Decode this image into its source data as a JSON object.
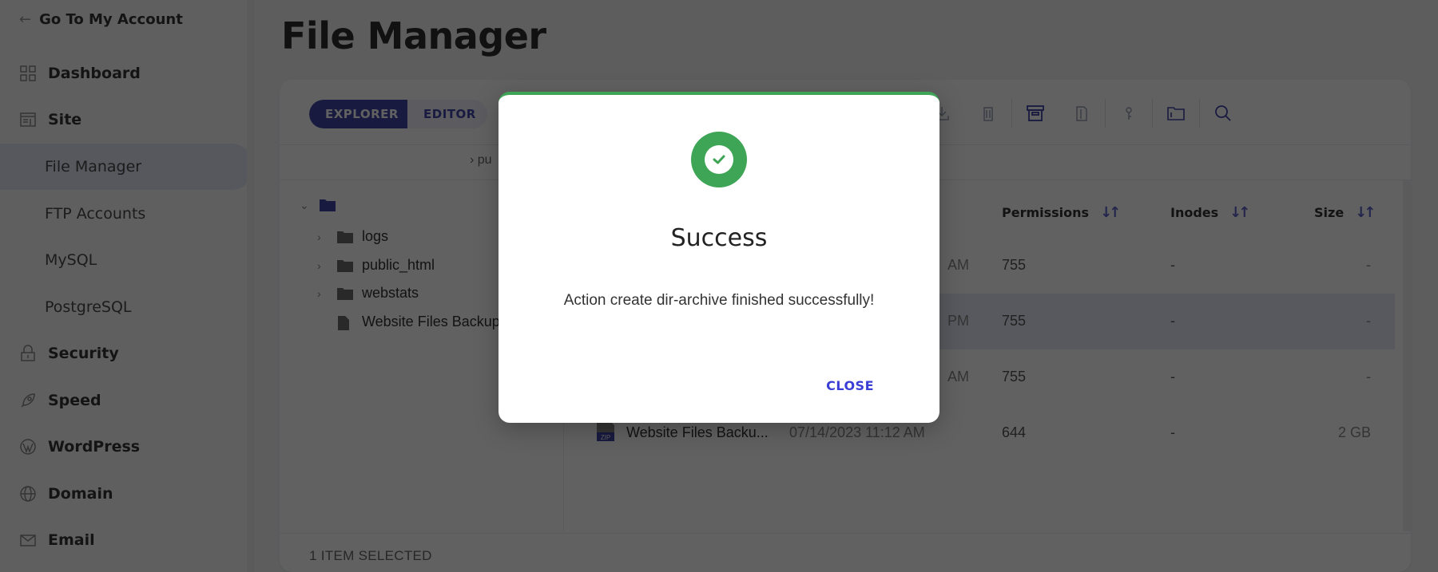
{
  "sidebar": {
    "back_label": "Go To My Account",
    "items": [
      {
        "label": "Dashboard",
        "icon": "dashboard-grid-icon"
      },
      {
        "label": "Site",
        "icon": "site-icon"
      },
      {
        "label": "File Manager",
        "sub": true,
        "active": true
      },
      {
        "label": "FTP Accounts",
        "sub": true
      },
      {
        "label": "MySQL",
        "sub": true
      },
      {
        "label": "PostgreSQL",
        "sub": true
      },
      {
        "label": "Security",
        "icon": "lock-icon"
      },
      {
        "label": "Speed",
        "icon": "rocket-icon"
      },
      {
        "label": "WordPress",
        "icon": "wordpress-icon"
      },
      {
        "label": "Domain",
        "icon": "globe-icon"
      },
      {
        "label": "Email",
        "icon": "envelope-icon"
      }
    ]
  },
  "page": {
    "title": "File Manager"
  },
  "toolbar": {
    "tabs": [
      {
        "label": "EXPLORER",
        "active": true
      },
      {
        "label": "EDITOR",
        "active": false
      }
    ],
    "icons": [
      "download-icon",
      "delete-icon",
      "archive-icon",
      "extract-icon",
      "permissions-icon",
      "folder-info-icon",
      "search-icon"
    ]
  },
  "breadcrumb": {
    "text": "pu"
  },
  "tree": {
    "root_label": "",
    "items": [
      {
        "label": "logs",
        "type": "folder"
      },
      {
        "label": "public_html",
        "type": "folder"
      },
      {
        "label": "webstats",
        "type": "folder"
      },
      {
        "label": "Website Files Backup",
        "type": "file"
      }
    ]
  },
  "table": {
    "columns": [
      "Permissions",
      "Inodes",
      "Size"
    ],
    "rows": [
      {
        "name": "",
        "date_suffix": "AM",
        "permissions": "755",
        "inodes": "-",
        "size": "-",
        "selected": false
      },
      {
        "name": "",
        "date_suffix": "PM",
        "permissions": "755",
        "inodes": "-",
        "size": "-",
        "selected": true
      },
      {
        "name": "",
        "date_suffix": "AM",
        "permissions": "755",
        "inodes": "-",
        "size": "-",
        "selected": false
      },
      {
        "name": "Website Files Backu...",
        "date": "07/14/2023 11:12 AM",
        "permissions": "644",
        "inodes": "-",
        "size": "2 GB",
        "selected": false,
        "badge": "ZIP"
      }
    ]
  },
  "footer": {
    "selection": "1 ITEM SELECTED"
  },
  "modal": {
    "title": "Success",
    "message": "Action create dir-archive finished successfully!",
    "close_label": "CLOSE",
    "accent": "#3fa556",
    "button_color": "#3a3ed4"
  }
}
